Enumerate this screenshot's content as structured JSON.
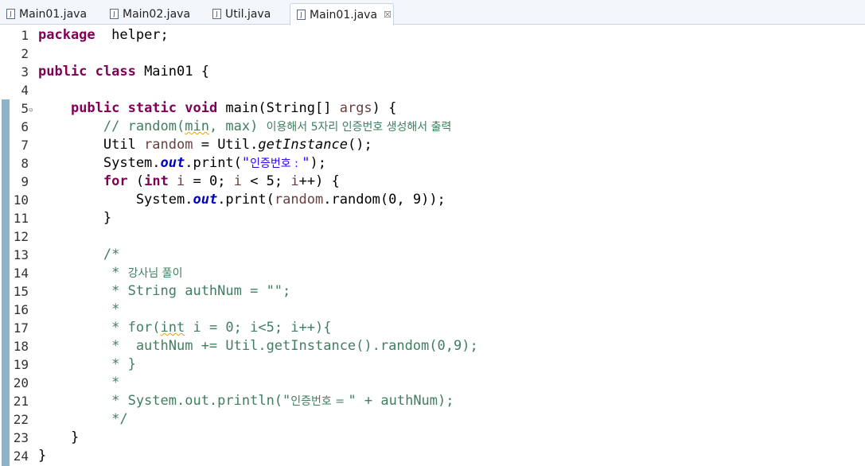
{
  "tabs": [
    {
      "label": "Main01.java",
      "active": false
    },
    {
      "label": "Main02.java",
      "active": false
    },
    {
      "label": "Util.java",
      "active": false
    },
    {
      "label": "Main01.java",
      "active": true
    }
  ],
  "close_glyph": "☒",
  "file_icon": "J",
  "lines": [
    {
      "n": "1",
      "parts": [
        [
          "kw",
          "package"
        ],
        [
          "",
          "  helper;"
        ]
      ]
    },
    {
      "n": "2",
      "parts": []
    },
    {
      "n": "3",
      "parts": [
        [
          "kw",
          "public class "
        ],
        [
          "",
          "Main01 {"
        ]
      ]
    },
    {
      "n": "4",
      "parts": []
    },
    {
      "n": "5",
      "parts": [
        [
          "",
          "    "
        ],
        [
          "kw",
          "public static void "
        ],
        [
          "",
          "main(String[] "
        ],
        [
          "param",
          "args"
        ],
        [
          "",
          ") {"
        ]
      ]
    },
    {
      "n": "6",
      "parts": [
        [
          "cm",
          "        // random("
        ],
        [
          "cm squig",
          "min"
        ],
        [
          "cm",
          ", max) "
        ],
        [
          "cm kr",
          "이용해서 5자리 인증번호 생성해서 출력"
        ]
      ]
    },
    {
      "n": "7",
      "parts": [
        [
          "",
          "        Util "
        ],
        [
          "varc",
          "random"
        ],
        [
          "",
          " = Util."
        ],
        [
          "itl",
          "getInstance"
        ],
        [
          "",
          "();"
        ]
      ]
    },
    {
      "n": "8",
      "parts": [
        [
          "",
          "        System."
        ],
        [
          "fld",
          "out"
        ],
        [
          "",
          ".print("
        ],
        [
          "str",
          "\""
        ],
        [
          "str kr",
          "인증번호 : "
        ],
        [
          "str",
          "\""
        ],
        [
          "",
          ");"
        ]
      ]
    },
    {
      "n": "9",
      "parts": [
        [
          "",
          "        "
        ],
        [
          "kw",
          "for "
        ],
        [
          "",
          "("
        ],
        [
          "kw",
          "int "
        ],
        [
          "varc",
          "i"
        ],
        [
          "",
          " = 0; "
        ],
        [
          "varc",
          "i"
        ],
        [
          "",
          " < 5; "
        ],
        [
          "varc",
          "i"
        ],
        [
          "",
          "++) {"
        ]
      ]
    },
    {
      "n": "10",
      "parts": [
        [
          "",
          "            System."
        ],
        [
          "fld",
          "out"
        ],
        [
          "",
          ".print("
        ],
        [
          "varc",
          "random"
        ],
        [
          "",
          ".random(0, 9));"
        ]
      ]
    },
    {
      "n": "11",
      "parts": [
        [
          "",
          "        }"
        ]
      ]
    },
    {
      "n": "12",
      "parts": []
    },
    {
      "n": "13",
      "parts": [
        [
          "cm",
          "        /*"
        ]
      ]
    },
    {
      "n": "14",
      "parts": [
        [
          "cm",
          "         * "
        ],
        [
          "cm kr",
          "강사님 풀이"
        ]
      ]
    },
    {
      "n": "15",
      "parts": [
        [
          "cm",
          "         * String authNum = \"\";"
        ]
      ]
    },
    {
      "n": "16",
      "parts": [
        [
          "cm",
          "         *"
        ]
      ]
    },
    {
      "n": "17",
      "parts": [
        [
          "cm",
          "         * for("
        ],
        [
          "cm squig",
          "int"
        ],
        [
          "cm",
          " i = 0; i<5; i++){"
        ]
      ]
    },
    {
      "n": "18",
      "parts": [
        [
          "cm",
          "         *  authNum += Util.getInstance().random(0,9);"
        ]
      ]
    },
    {
      "n": "19",
      "parts": [
        [
          "cm",
          "         * }"
        ]
      ]
    },
    {
      "n": "20",
      "parts": [
        [
          "cm",
          "         *"
        ]
      ]
    },
    {
      "n": "21",
      "parts": [
        [
          "cm",
          "         * System.out.println(\""
        ],
        [
          "cm kr",
          "인증번호 = "
        ],
        [
          "cm",
          "\" + authNum);"
        ]
      ]
    },
    {
      "n": "22",
      "parts": [
        [
          "cm",
          "         */"
        ]
      ]
    },
    {
      "n": "23",
      "parts": [
        [
          "",
          "    }"
        ]
      ]
    },
    {
      "n": "24",
      "parts": [
        [
          "",
          "}"
        ]
      ]
    }
  ]
}
